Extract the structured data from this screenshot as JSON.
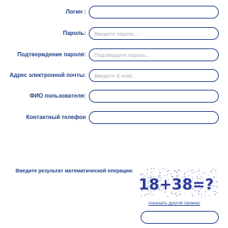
{
  "form": {
    "fields": [
      {
        "label": "Логин :",
        "placeholder": ""
      },
      {
        "label": "Пароль:",
        "placeholder": "Введите пароль..."
      },
      {
        "label": "Подтверждение пароля:",
        "placeholder": "Подтвердите пароль..."
      },
      {
        "label": "Адрес электронной почты:",
        "placeholder": "Введите E-mail..."
      },
      {
        "label": "ФИО пользователя:",
        "placeholder": ""
      },
      {
        "label": "Контактный телефон",
        "placeholder": ""
      }
    ]
  },
  "captcha": {
    "label": "Введите результат математической операции:",
    "image_text": "18+38=?",
    "refresh_link": "показать другой пример",
    "answer_placeholder": ""
  },
  "colors": {
    "label": "#1f3f86",
    "border": "#1f3f86",
    "captcha_ink": "#2b3a9c",
    "link": "#2d4fa3"
  }
}
